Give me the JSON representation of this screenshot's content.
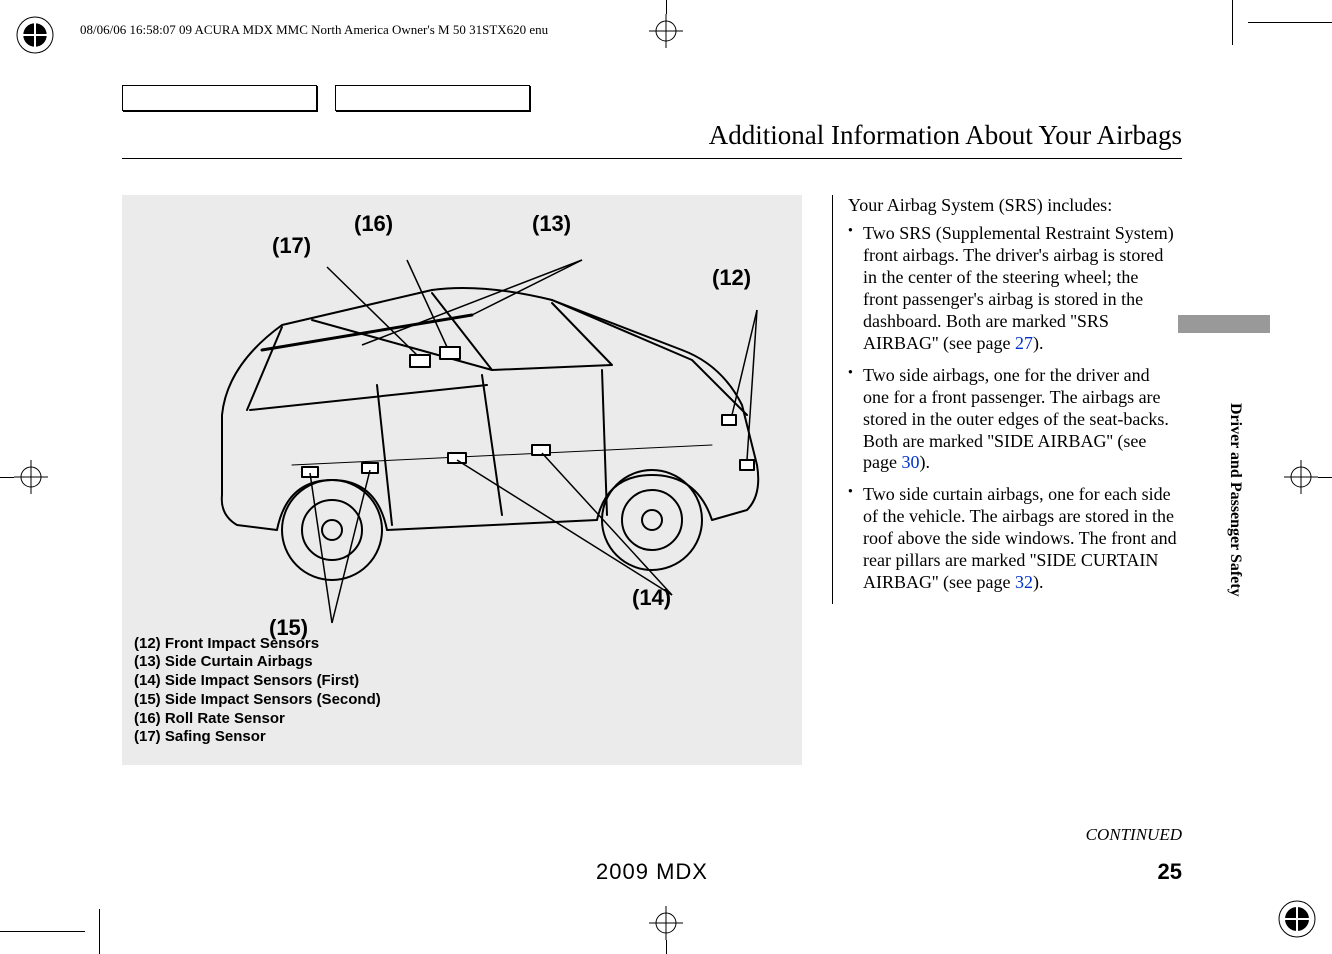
{
  "meta": {
    "header_line": "08/06/06 16:58:07   09 ACURA MDX MMC North America Owner's M 50 31STX620 enu"
  },
  "title": "Additional Information About Your Airbags",
  "diagram": {
    "callouts": {
      "c12": "(12)",
      "c13": "(13)",
      "c14": "(14)",
      "c15": "(15)",
      "c16": "(16)",
      "c17": "(17)"
    },
    "legend": {
      "l12": "(12) Front Impact Sensors",
      "l13": "(13) Side Curtain Airbags",
      "l14": "(14) Side Impact Sensors (First)",
      "l15": "(15) Side Impact Sensors (Second)",
      "l16": "(16) Roll Rate Sensor",
      "l17": "(17) Safing Sensor"
    }
  },
  "text": {
    "intro": "Your Airbag System (SRS) includes:",
    "bullet1_a": "Two SRS (Supplemental Restraint System) front airbags. The driver's airbag is stored in the center of the steering wheel; the front passenger's airbag is stored in the dashboard. Both are marked ''SRS AIRBAG'' (see page ",
    "bullet1_ref": "27",
    "bullet1_b": ").",
    "bullet2_a": "Two side airbags, one for the driver and one for a front passenger. The airbags are stored in the outer edges of the seat-backs. Both are marked ''SIDE AIRBAG'' (see page ",
    "bullet2_ref": "30",
    "bullet2_b": ").",
    "bullet3_a": "Two side curtain airbags, one for each side of the vehicle. The airbags are stored in the roof above the side windows. The front and rear pillars are marked ''SIDE CURTAIN AIRBAG'' (see page ",
    "bullet3_ref": "32",
    "bullet3_b": ")."
  },
  "side_tab": "Driver and Passenger Safety",
  "footer": {
    "continued": "CONTINUED",
    "model": "2009  MDX",
    "page": "25"
  }
}
